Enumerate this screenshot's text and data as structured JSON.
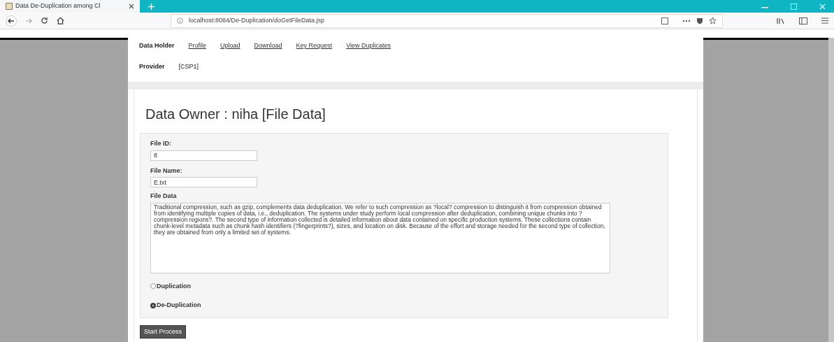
{
  "browser": {
    "tab_title": "Data De-Duplication among Cl",
    "url": "localhost:8084/De-Duplication/doGetFileData.jsp"
  },
  "nav": [
    {
      "label": "Data Holder",
      "kind": "label"
    },
    {
      "label": "Profile",
      "kind": "link"
    },
    {
      "label": "Upload",
      "kind": "link"
    },
    {
      "label": "Download",
      "kind": "link"
    },
    {
      "label": "Key Request",
      "kind": "link"
    },
    {
      "label": "View Duplicates",
      "kind": "link"
    }
  ],
  "provider": {
    "label": "Provider",
    "value": "[CSP1]"
  },
  "heading": "Data Owner : niha [File Data]",
  "fields": [
    {
      "label": "File ID:",
      "value": "8"
    },
    {
      "label": "File Name:",
      "value": "E.txt"
    }
  ],
  "file_data": {
    "label": "File Data",
    "value": "Traditional compression, such as gzip, complements data deduplication. We refer to such compression as ?local? compression to distinguish it from compression obtained from identifying multiple copies of data, i.e., deduplication. The systems under study perform local compression after deduplication, combining unique chunks into ?compression regions?. The second type of information collected is detailed information about data contained on specific production systems. These collections contain chunk-level metadata such as chunk hash identifiers (?fingerprints?), sizes, and location on disk. Because of the effort and storage needed for the second type of collection, they are obtained from only a limited set of systems."
  },
  "options": [
    {
      "label": "Duplication",
      "selected": false
    },
    {
      "label": "De-Duplication",
      "selected": true
    }
  ],
  "submit": "Start Process"
}
